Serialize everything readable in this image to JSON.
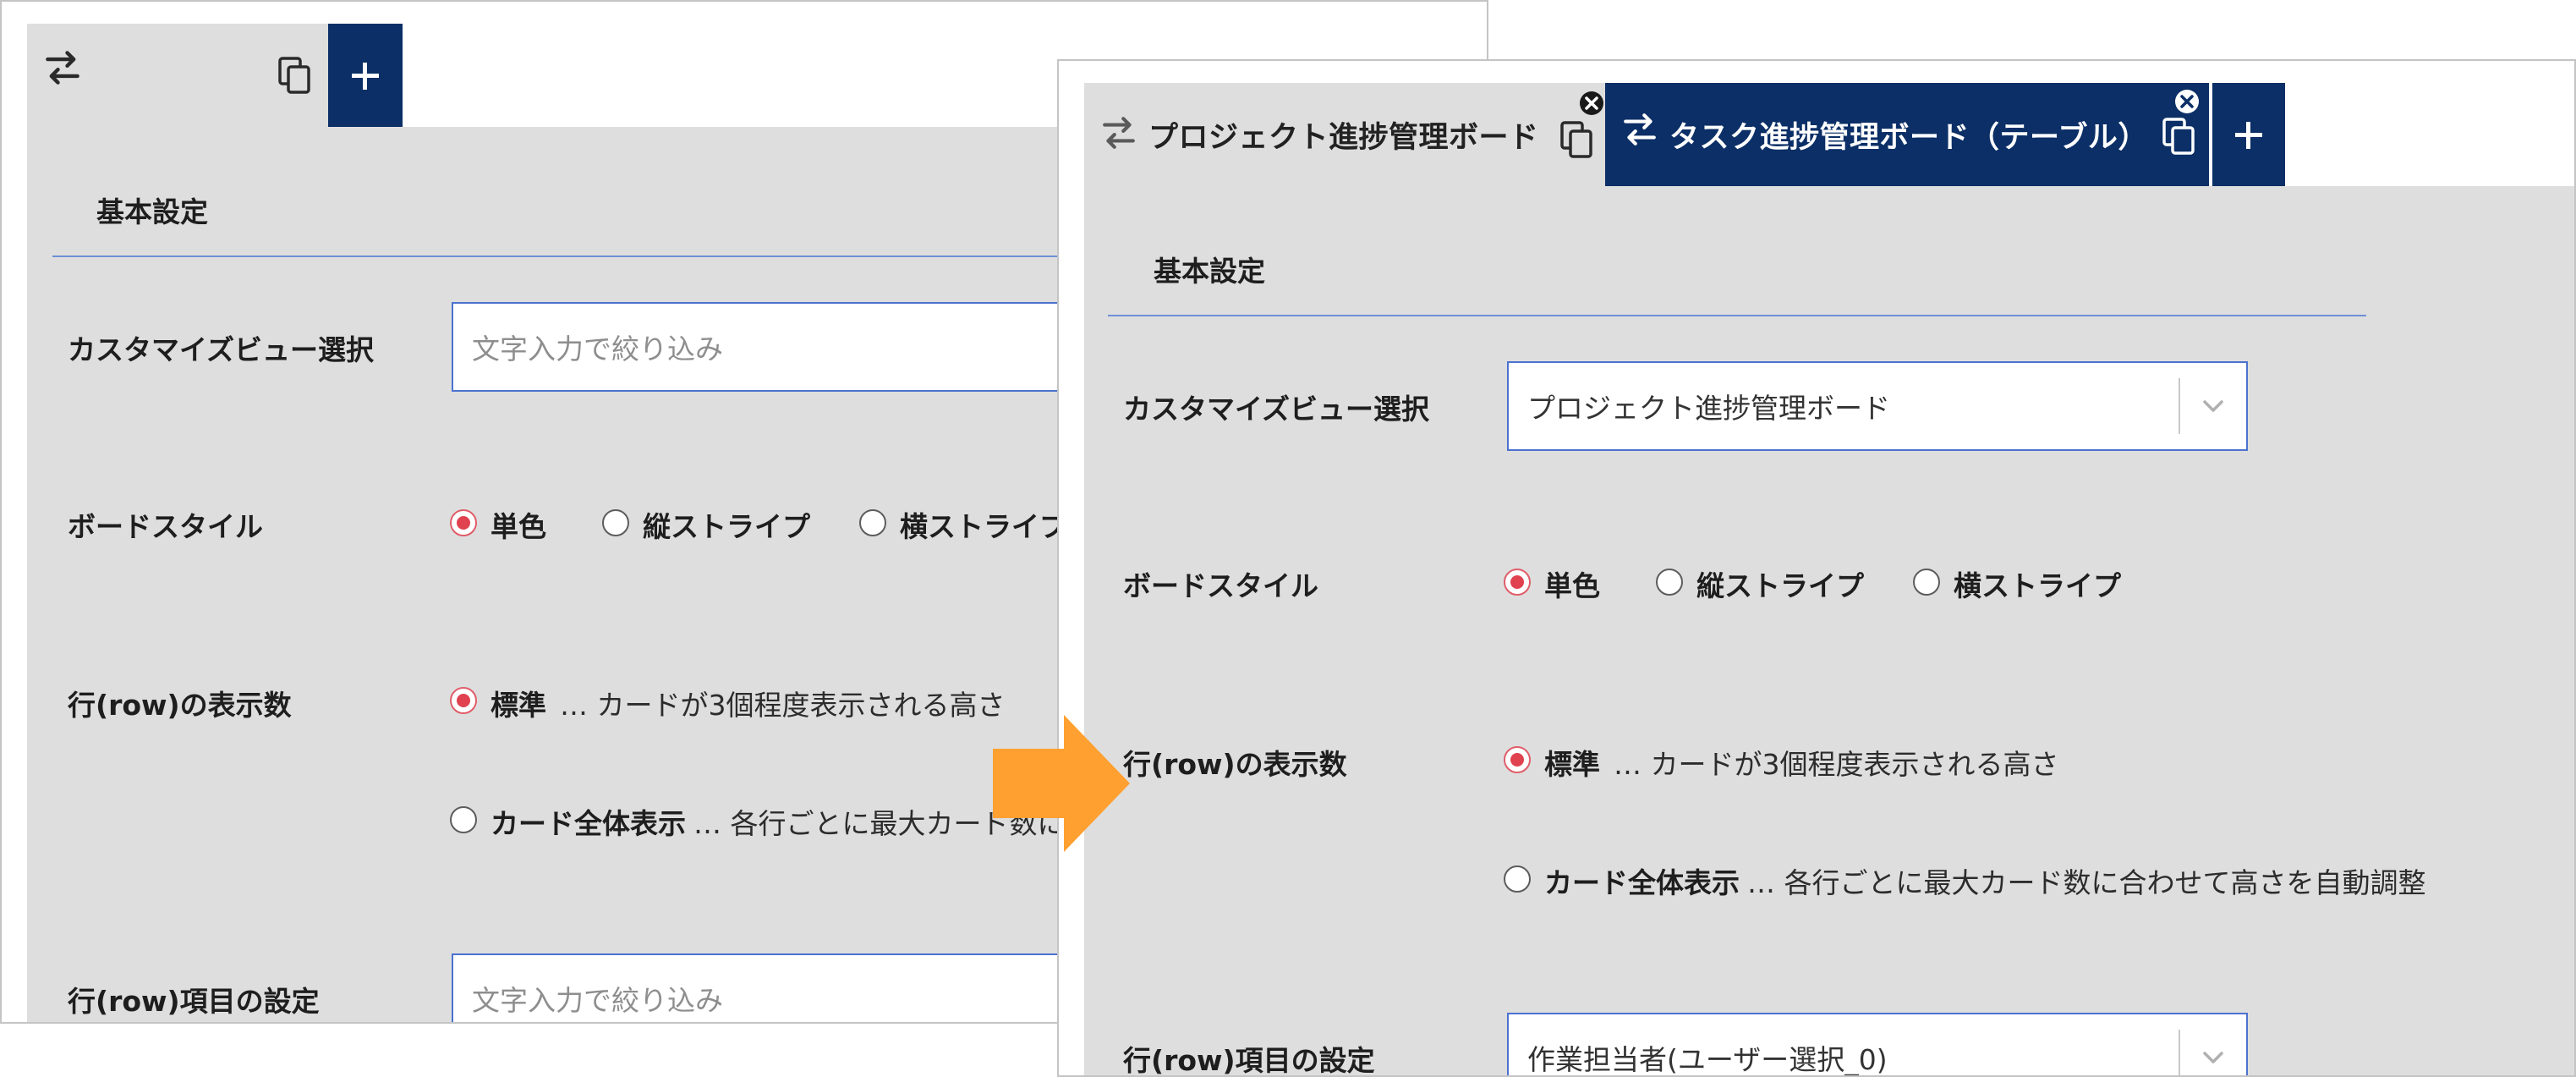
{
  "colors": {
    "tab_active_bg": "#0b2f66",
    "panel_bg": "#dedede",
    "input_border": "#4b72cf",
    "radio_selected": "#e0424f",
    "arrow": "#ffa030"
  },
  "icons": [
    "swap-arrows-icon",
    "copy-icon",
    "plus-icon",
    "close-circle-icon",
    "chevron-down-icon",
    "arrow-right-icon"
  ],
  "before": {
    "section_title": "基本設定",
    "custom_view": {
      "label": "カスタマイズビュー選択",
      "placeholder": "文字入力で絞り込み"
    },
    "board_style": {
      "label": "ボードスタイル",
      "options": [
        "単色",
        "縦ストライプ",
        "横ストライプ"
      ],
      "selected": "単色"
    },
    "row_count": {
      "label": "行(row)の表示数",
      "option_standard": "標準",
      "option_standard_desc": "… カードが3個程度表示される高さ",
      "option_full": "カード全体表示",
      "option_full_desc": "… 各行ごとに最大カード数に"
    },
    "row_item": {
      "label": "行(row)項目の設定",
      "placeholder": "文字入力で絞り込み"
    }
  },
  "after": {
    "tabs": [
      {
        "label": "プロジェクト進捗管理ボード",
        "active": false
      },
      {
        "label": "タスク進捗管理ボード（テーブル）",
        "active": true
      }
    ],
    "section_title": "基本設定",
    "custom_view": {
      "label": "カスタマイズビュー選択",
      "value": "プロジェクト進捗管理ボード"
    },
    "board_style": {
      "label": "ボードスタイル",
      "options": [
        "単色",
        "縦ストライプ",
        "横ストライプ"
      ],
      "selected": "単色"
    },
    "row_count": {
      "label": "行(row)の表示数",
      "option_standard": "標準",
      "option_standard_desc": "… カードが3個程度表示される高さ",
      "option_full": "カード全体表示",
      "option_full_desc": "… 各行ごとに最大カード数に合わせて高さを自動調整"
    },
    "row_item": {
      "label": "行(row)項目の設定",
      "value": "作業担当者(ユーザー選択_0)"
    }
  }
}
